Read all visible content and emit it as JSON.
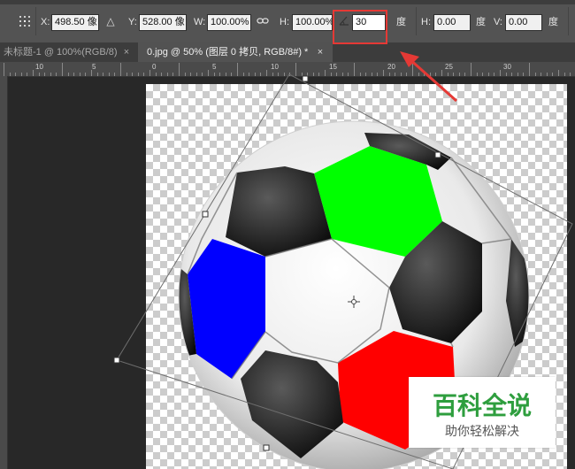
{
  "options_bar": {
    "x_label": "X:",
    "x_value": "498.50 像",
    "y_label": "Y:",
    "y_value": "528.00 像",
    "w_label": "W:",
    "w_value": "100.00%",
    "h_label": "H:",
    "h_value": "100.00%",
    "angle_value": "30",
    "angle_unit": "度",
    "hskew_label": "H:",
    "hskew_value": "0.00",
    "hskew_unit": "度",
    "vskew_label": "V:",
    "vskew_value": "0.00",
    "vskew_unit": "度",
    "icons": [
      "reference-point-icon",
      "delta-icon",
      "link-icon",
      "angle-icon"
    ]
  },
  "tabs": [
    {
      "label": "未标题-1 @ 100%(RGB/8)",
      "close": "×"
    },
    {
      "label": "0.jpg @ 50% (图层 0 拷贝, RGB/8#) *",
      "close": "×"
    }
  ],
  "ruler_h_labels": [
    "10",
    "5",
    "0",
    "5",
    "10",
    "15",
    "20",
    "25",
    "30"
  ],
  "watermark": {
    "title": "百科全说",
    "subtitle": "助你轻松解决"
  },
  "colors": {
    "annotation_red": "#e53935",
    "watermark_green": "#2e9e3e",
    "patch_green": "#00ff00",
    "patch_blue": "#0000ff",
    "patch_red": "#ff0000"
  }
}
